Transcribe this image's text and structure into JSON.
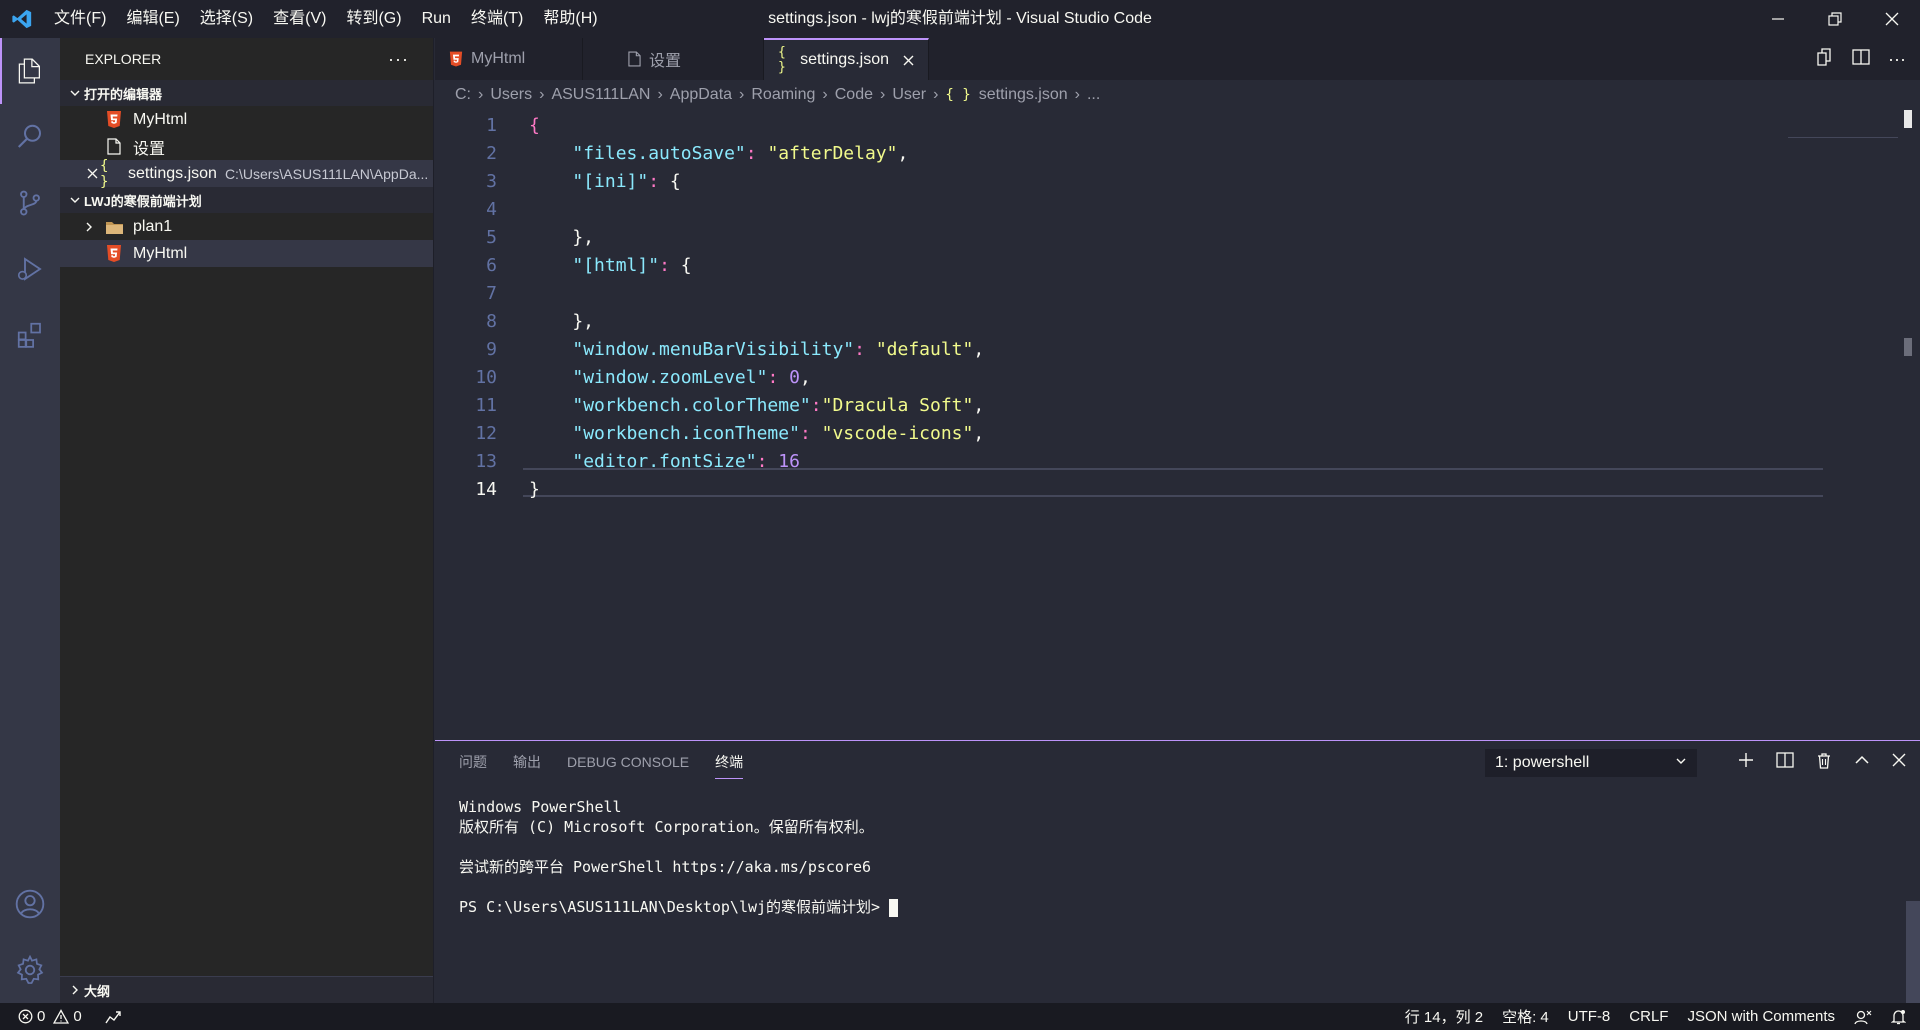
{
  "window": {
    "title": "settings.json - lwj的寒假前端计划 - Visual Studio Code",
    "menu": [
      "文件(F)",
      "编辑(E)",
      "选择(S)",
      "查看(V)",
      "转到(G)",
      "Run",
      "终端(T)",
      "帮助(H)"
    ]
  },
  "sidebar": {
    "title": "EXPLORER",
    "open_editors": {
      "label": "打开的编辑器",
      "items": [
        {
          "name": "MyHtml",
          "icon": "html5-icon"
        },
        {
          "name": "设置",
          "icon": "file-icon"
        },
        {
          "name": "settings.json",
          "path": "C:\\Users\\ASUS111LAN\\AppDa...",
          "icon": "json-braces-icon"
        }
      ]
    },
    "workspace": {
      "label": "LWJ的寒假前端计划",
      "items": [
        {
          "name": "plan1",
          "icon": "folder-icon"
        },
        {
          "name": "MyHtml",
          "icon": "html5-icon"
        }
      ]
    },
    "outline_label": "大纲"
  },
  "tabs": [
    {
      "label": "MyHtml",
      "icon": "html5-icon",
      "active": false
    },
    {
      "label": "设置",
      "icon": "file-icon",
      "active": false
    },
    {
      "label": "settings.json",
      "icon": "json-braces-icon",
      "active": true
    }
  ],
  "breadcrumb": [
    "C:",
    "Users",
    "ASUS111LAN",
    "AppData",
    "Roaming",
    "Code",
    "User",
    "settings.json",
    "..."
  ],
  "editor": {
    "current_line": 14,
    "lines": [
      {
        "n": "1",
        "tokens": [
          [
            "p",
            "{"
          ]
        ]
      },
      {
        "n": "2",
        "tokens": [
          [
            "t",
            "    "
          ],
          [
            "k",
            "\"files.autoSave\""
          ],
          [
            "p",
            ": "
          ],
          [
            "s",
            "\"afterDelay\""
          ],
          [
            "t",
            ","
          ]
        ]
      },
      {
        "n": "3",
        "tokens": [
          [
            "t",
            "    "
          ],
          [
            "k",
            "\"[ini]\""
          ],
          [
            "p",
            ": "
          ],
          [
            "t",
            "{"
          ]
        ]
      },
      {
        "n": "4",
        "tokens": []
      },
      {
        "n": "5",
        "tokens": [
          [
            "t",
            "    },"
          ]
        ]
      },
      {
        "n": "6",
        "tokens": [
          [
            "t",
            "    "
          ],
          [
            "k",
            "\"[html]\""
          ],
          [
            "p",
            ": "
          ],
          [
            "t",
            "{"
          ]
        ]
      },
      {
        "n": "7",
        "tokens": []
      },
      {
        "n": "8",
        "tokens": [
          [
            "t",
            "    },"
          ]
        ]
      },
      {
        "n": "9",
        "tokens": [
          [
            "t",
            "    "
          ],
          [
            "k",
            "\"window.menuBarVisibility\""
          ],
          [
            "p",
            ": "
          ],
          [
            "s",
            "\"default\""
          ],
          [
            "t",
            ","
          ]
        ]
      },
      {
        "n": "10",
        "tokens": [
          [
            "t",
            "    "
          ],
          [
            "k",
            "\"window.zoomLevel\""
          ],
          [
            "p",
            ": "
          ],
          [
            "n",
            "0"
          ],
          [
            "t",
            ","
          ]
        ]
      },
      {
        "n": "11",
        "tokens": [
          [
            "t",
            "    "
          ],
          [
            "k",
            "\"workbench.colorTheme\""
          ],
          [
            "p",
            ":"
          ],
          [
            "s",
            "\"Dracula Soft\""
          ],
          [
            "t",
            ","
          ]
        ]
      },
      {
        "n": "12",
        "tokens": [
          [
            "t",
            "    "
          ],
          [
            "k",
            "\"workbench.iconTheme\""
          ],
          [
            "p",
            ": "
          ],
          [
            "s",
            "\"vscode-icons\""
          ],
          [
            "t",
            ","
          ]
        ]
      },
      {
        "n": "13",
        "tokens": [
          [
            "t",
            "    "
          ],
          [
            "k",
            "\"editor.fontSize\""
          ],
          [
            "p",
            ": "
          ],
          [
            "n",
            "16"
          ]
        ]
      },
      {
        "n": "14",
        "tokens": [
          [
            "t",
            "}"
          ]
        ]
      }
    ]
  },
  "panel": {
    "tabs": [
      "问题",
      "输出",
      "DEBUG CONSOLE",
      "终端"
    ],
    "active_tab": "终端",
    "terminal_select": "1: powershell",
    "terminal_lines": [
      "Windows PowerShell",
      "版权所有 (C) Microsoft Corporation。保留所有权利。",
      "",
      "尝试新的跨平台 PowerShell https://aka.ms/pscore6",
      "",
      "PS C:\\Users\\ASUS111LAN\\Desktop\\lwj的寒假前端计划> "
    ]
  },
  "status": {
    "errors": "0",
    "warnings": "0",
    "position": "行 14，列 2",
    "indent": "空格: 4",
    "encoding": "UTF-8",
    "eol": "CRLF",
    "language": "JSON with Comments"
  },
  "colors": {
    "accent": "#bd93f9",
    "html_icon": "#e44d26",
    "json_icon": "#f1fa8c",
    "folder_icon": "#c09553"
  }
}
